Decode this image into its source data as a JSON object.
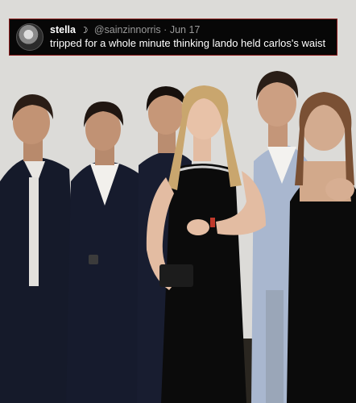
{
  "tweet": {
    "display_name": "stella",
    "name_icon": "crescent-moon-icon",
    "moon_glyph": "☽",
    "handle": "@sainzinnorris",
    "separator": "·",
    "date": "Jun 17",
    "text": "tripped for a whole minute thinking lando held carlos's waist"
  },
  "colors": {
    "tweet_background": "#070707",
    "tweet_border": "#8c1c1c",
    "photo_background": "#d9d8d5",
    "suit_dark": "#151a2a",
    "suit_light": "#a9b7cf",
    "dress": "#0b0b0b"
  }
}
